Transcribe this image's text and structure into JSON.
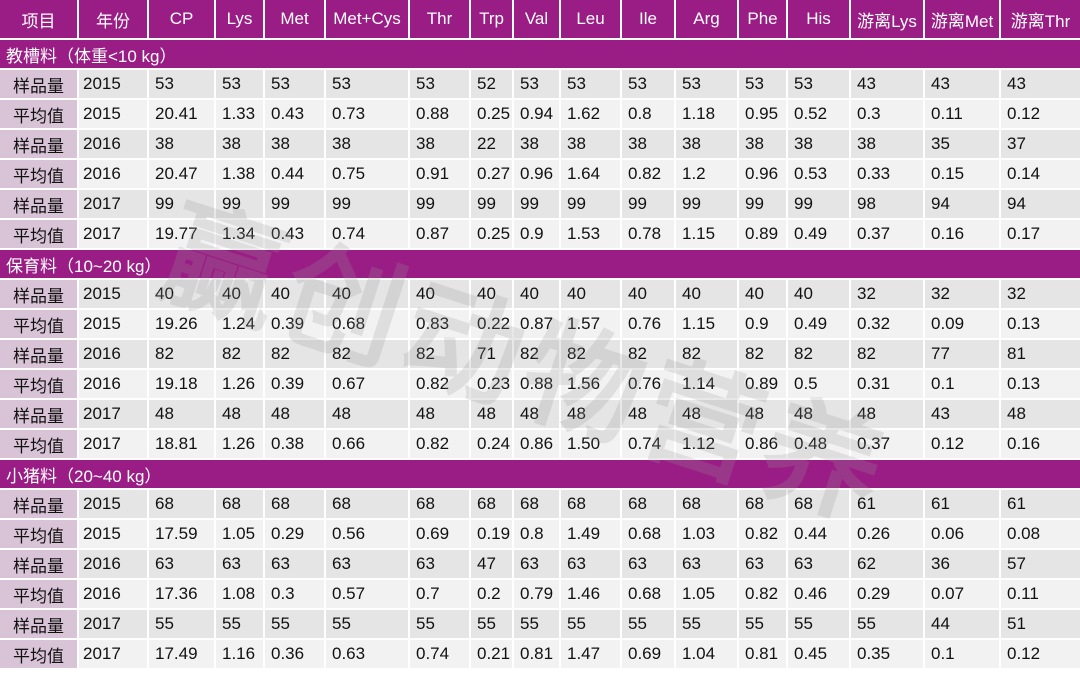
{
  "table": {
    "columns": [
      "项目",
      "年份",
      "CP",
      "Lys",
      "Met",
      "Met+Cys",
      "Thr",
      "Trp",
      "Val",
      "Leu",
      "Ile",
      "Arg",
      "Phe",
      "His",
      "游离Lys",
      "游离Met",
      "游离Thr"
    ],
    "sections": [
      {
        "title": "教槽料（体重<10 kg）",
        "rows": [
          [
            "样品量",
            "2015",
            "53",
            "53",
            "53",
            "53",
            "53",
            "52",
            "53",
            "53",
            "53",
            "53",
            "53",
            "53",
            "43",
            "43",
            "43"
          ],
          [
            "平均值",
            "2015",
            "20.41",
            "1.33",
            "0.43",
            "0.73",
            "0.88",
            "0.25",
            "0.94",
            "1.62",
            "0.8",
            "1.18",
            "0.95",
            "0.52",
            "0.3",
            "0.11",
            "0.12"
          ],
          [
            "样品量",
            "2016",
            "38",
            "38",
            "38",
            "38",
            "38",
            "22",
            "38",
            "38",
            "38",
            "38",
            "38",
            "38",
            "38",
            "35",
            "37"
          ],
          [
            "平均值",
            "2016",
            "20.47",
            "1.38",
            "0.44",
            "0.75",
            "0.91",
            "0.27",
            "0.96",
            "1.64",
            "0.82",
            "1.2",
            "0.96",
            "0.53",
            "0.33",
            "0.15",
            "0.14"
          ],
          [
            "样品量",
            "2017",
            "99",
            "99",
            "99",
            "99",
            "99",
            "99",
            "99",
            "99",
            "99",
            "99",
            "99",
            "99",
            "98",
            "94",
            "94"
          ],
          [
            "平均值",
            "2017",
            "19.77",
            "1.34",
            "0.43",
            "0.74",
            "0.87",
            "0.25",
            "0.9",
            "1.53",
            "0.78",
            "1.15",
            "0.89",
            "0.49",
            "0.37",
            "0.16",
            "0.17"
          ]
        ]
      },
      {
        "title": "保育料（10~20 kg）",
        "rows": [
          [
            "样品量",
            "2015",
            "40",
            "40",
            "40",
            "40",
            "40",
            "40",
            "40",
            "40",
            "40",
            "40",
            "40",
            "40",
            "32",
            "32",
            "32"
          ],
          [
            "平均值",
            "2015",
            "19.26",
            "1.24",
            "0.39",
            "0.68",
            "0.83",
            "0.22",
            "0.87",
            "1.57",
            "0.76",
            "1.15",
            "0.9",
            "0.49",
            "0.32",
            "0.09",
            "0.13"
          ],
          [
            "样品量",
            "2016",
            "82",
            "82",
            "82",
            "82",
            "82",
            "71",
            "82",
            "82",
            "82",
            "82",
            "82",
            "82",
            "82",
            "77",
            "81"
          ],
          [
            "平均值",
            "2016",
            "19.18",
            "1.26",
            "0.39",
            "0.67",
            "0.82",
            "0.23",
            "0.88",
            "1.56",
            "0.76",
            "1.14",
            "0.89",
            "0.5",
            "0.31",
            "0.1",
            "0.13"
          ],
          [
            "样品量",
            "2017",
            "48",
            "48",
            "48",
            "48",
            "48",
            "48",
            "48",
            "48",
            "48",
            "48",
            "48",
            "48",
            "48",
            "43",
            "48"
          ],
          [
            "平均值",
            "2017",
            "18.81",
            "1.26",
            "0.38",
            "0.66",
            "0.82",
            "0.24",
            "0.86",
            "1.50",
            "0.74",
            "1.12",
            "0.86",
            "0.48",
            "0.37",
            "0.12",
            "0.16"
          ]
        ]
      },
      {
        "title": "小猪料（20~40 kg）",
        "rows": [
          [
            "样品量",
            "2015",
            "68",
            "68",
            "68",
            "68",
            "68",
            "68",
            "68",
            "68",
            "68",
            "68",
            "68",
            "68",
            "61",
            "61",
            "61"
          ],
          [
            "平均值",
            "2015",
            "17.59",
            "1.05",
            "0.29",
            "0.56",
            "0.69",
            "0.19",
            "0.8",
            "1.49",
            "0.68",
            "1.03",
            "0.82",
            "0.44",
            "0.26",
            "0.06",
            "0.08"
          ],
          [
            "样品量",
            "2016",
            "63",
            "63",
            "63",
            "63",
            "63",
            "47",
            "63",
            "63",
            "63",
            "63",
            "63",
            "63",
            "62",
            "36",
            "57"
          ],
          [
            "平均值",
            "2016",
            "17.36",
            "1.08",
            "0.3",
            "0.57",
            "0.7",
            "0.2",
            "0.79",
            "1.46",
            "0.68",
            "1.05",
            "0.82",
            "0.46",
            "0.29",
            "0.07",
            "0.11"
          ],
          [
            "样品量",
            "2017",
            "55",
            "55",
            "55",
            "55",
            "55",
            "55",
            "55",
            "55",
            "55",
            "55",
            "55",
            "55",
            "55",
            "44",
            "51"
          ],
          [
            "平均值",
            "2017",
            "17.49",
            "1.16",
            "0.36",
            "0.63",
            "0.74",
            "0.21",
            "0.81",
            "1.47",
            "0.69",
            "1.04",
            "0.81",
            "0.45",
            "0.35",
            "0.1",
            "0.12"
          ]
        ]
      }
    ]
  },
  "watermark": "赢创动物营养",
  "colors": {
    "header_bg": "#9a1d85",
    "label_bg": "#d9c3d6",
    "row_odd_bg": "#e6e5e6",
    "row_even_bg": "#f3f2f3"
  }
}
